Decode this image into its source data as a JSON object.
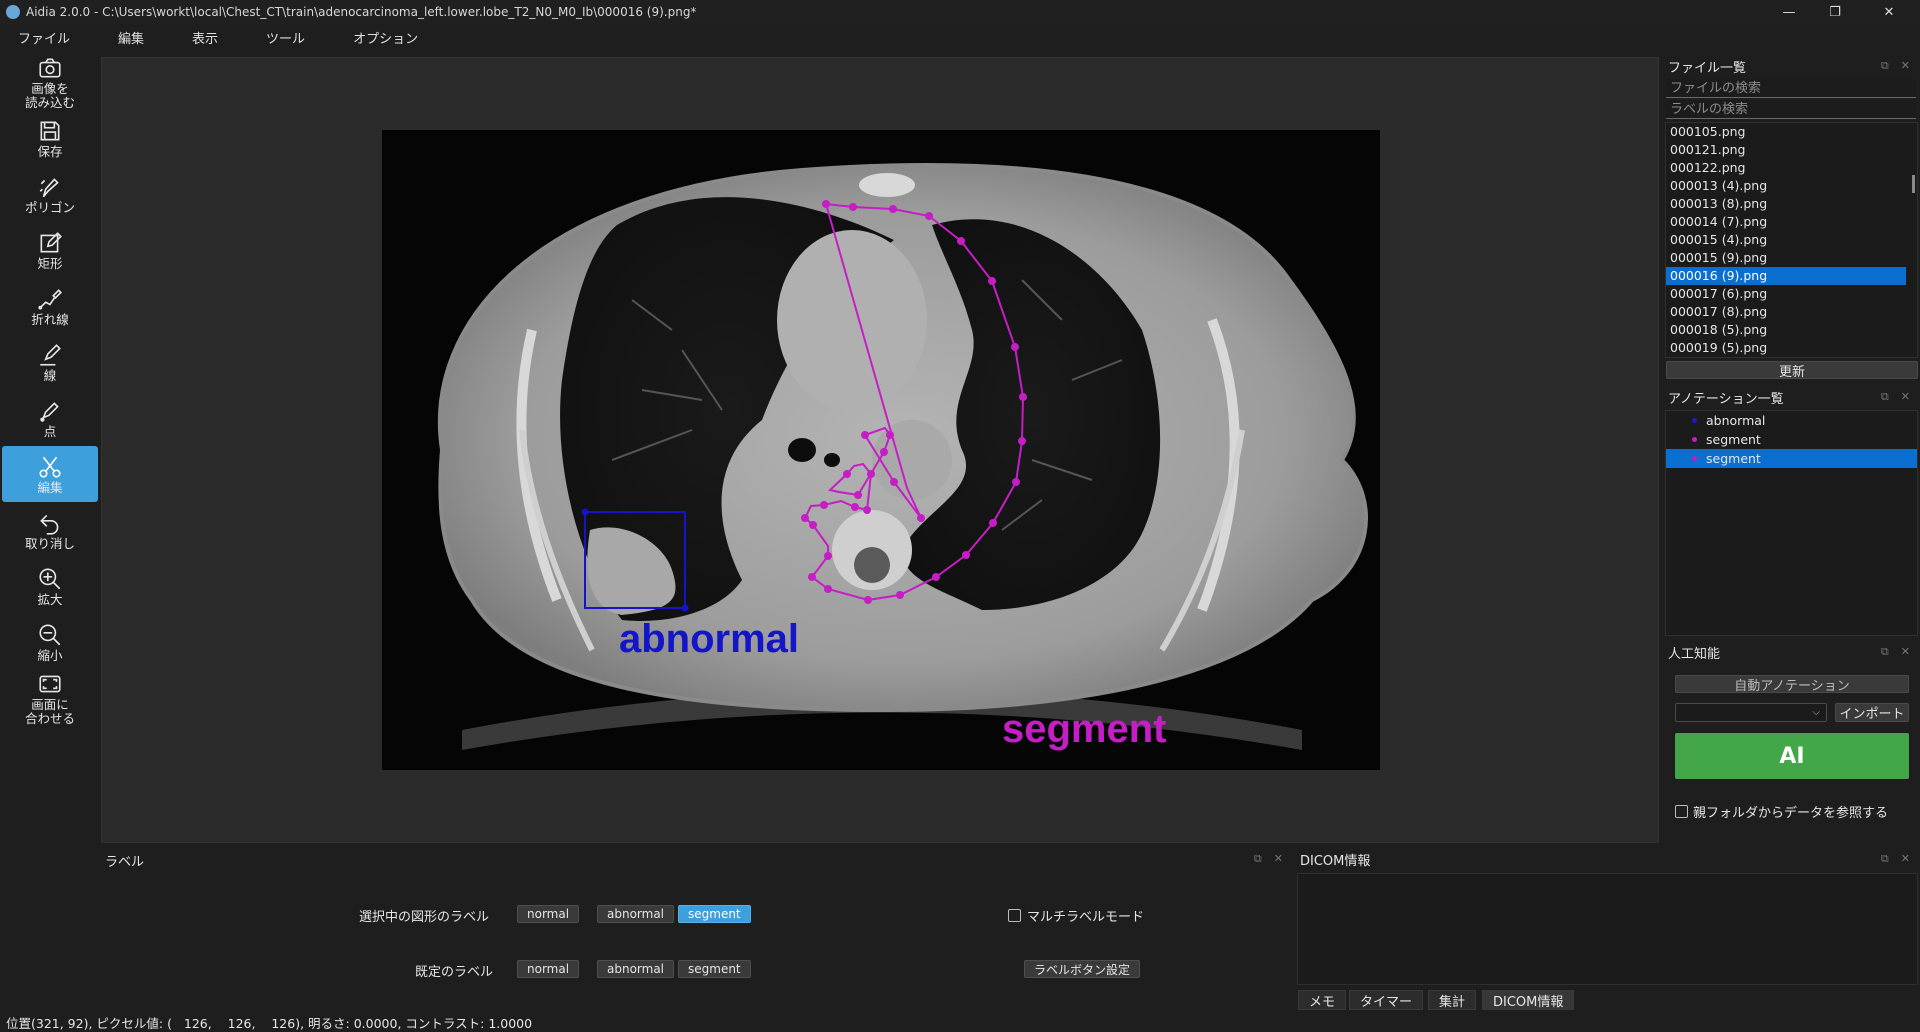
{
  "window": {
    "title": "Aidia 2.0.0 - C:\\Users\\workt\\local\\Chest_CT\\train\\adenocarcinoma_left.lower.lobe_T2_N0_M0_Ib\\000016 (9).png*",
    "minimize": "—",
    "maximize": "❐",
    "close": "✕"
  },
  "menu": [
    "ファイル",
    "編集",
    "表示",
    "ツール",
    "オプション"
  ],
  "toolbar": [
    {
      "name": "load-image-button",
      "icon": "camera-icon",
      "label": "画像を\n読み込む"
    },
    {
      "name": "save-button",
      "icon": "floppy-disk-icon",
      "label": "保存"
    },
    {
      "name": "polygon-button",
      "icon": "polygon-pen-icon",
      "label": "ポリゴン"
    },
    {
      "name": "rectangle-button",
      "icon": "rectangle-edit-icon",
      "label": "矩形"
    },
    {
      "name": "polyline-button",
      "icon": "polyline-icon",
      "label": "折れ線"
    },
    {
      "name": "line-button",
      "icon": "line-pen-icon",
      "label": "線"
    },
    {
      "name": "point-button",
      "icon": "point-pen-icon",
      "label": "点"
    },
    {
      "name": "edit-button",
      "icon": "scissors-icon",
      "label": "編集",
      "active": true
    },
    {
      "name": "undo-button",
      "icon": "undo-icon",
      "label": "取り消し"
    },
    {
      "name": "zoom-in-button",
      "icon": "zoom-in-icon",
      "label": "拡大"
    },
    {
      "name": "zoom-out-button",
      "icon": "zoom-out-icon",
      "label": "縮小"
    },
    {
      "name": "fit-window-button",
      "icon": "fit-screen-icon",
      "label": "画面に\n合わせる"
    }
  ],
  "canvas": {
    "shapes": [
      {
        "label": "abnormal",
        "type": "rectangle",
        "color": "#1414c8"
      },
      {
        "label": "segment",
        "type": "polygon",
        "color": "#c41ec4"
      }
    ]
  },
  "file_panel": {
    "title": "ファイル一覧",
    "search_placeholder": "ファイルの検索",
    "label_search_placeholder": "ラベルの検索",
    "files": [
      "000105.png",
      "000121.png",
      "000122.png",
      "000013 (4).png",
      "000013 (8).png",
      "000014 (7).png",
      "000015 (4).png",
      "000015 (9).png",
      "000016 (9).png",
      "000017 (6).png",
      "000017 (8).png",
      "000018 (5).png",
      "000019 (5).png"
    ],
    "selected_index": 8,
    "refresh_label": "更新"
  },
  "annotation_panel": {
    "title": "アノテーション一覧",
    "items": [
      {
        "label": "abnormal",
        "color": "#1a1ac8"
      },
      {
        "label": "segment",
        "color": "#c41ec4"
      },
      {
        "label": "segment",
        "color": "#c41ec4",
        "selected": true
      }
    ]
  },
  "ai_panel": {
    "title": "人工知能",
    "auto_annotation_label": "自動アノテーション",
    "model_select_value": "",
    "import_label": "インポート",
    "ai_button_label": "AI",
    "parent_folder_checkbox_label": "親フォルダからデータを参照する",
    "ai_color": "#43a649"
  },
  "label_panel": {
    "title": "ラベル",
    "selected_shape_label": "選択中の図形のラベル",
    "default_label": "既定のラベル",
    "labels": [
      "normal",
      "abnormal",
      "segment"
    ],
    "selected_shape_active": "segment",
    "multi_label_mode": "マルチラベルモード",
    "label_button_settings": "ラベルボタン設定",
    "accent_color": "#3d9fdc"
  },
  "dicom_panel": {
    "title": "DICOM情報",
    "tabs": [
      "メモ",
      "タイマー",
      "集計",
      "DICOM情報"
    ],
    "active_tab": "DICOM情報"
  },
  "status": {
    "text": "位置(321, 92), ピクセル値: (   126,    126,    126), 明るさ: 0.0000, コントラスト: 1.0000"
  }
}
